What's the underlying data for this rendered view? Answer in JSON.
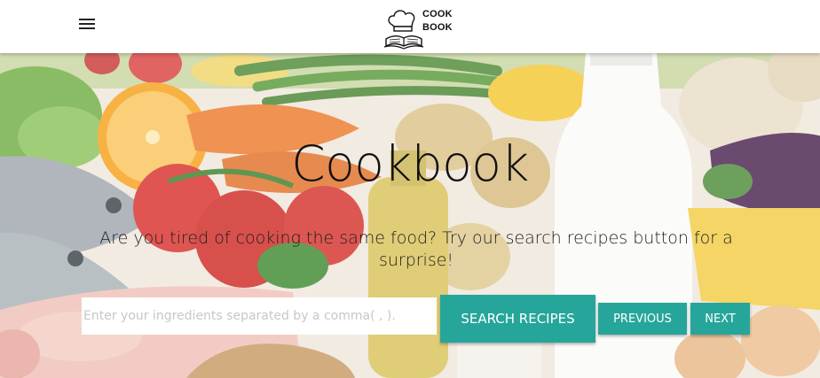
{
  "navbar": {
    "menu_icon": "hamburger-menu-icon",
    "logo_icon": "chef-hat-book-icon",
    "logo_line1": "COOK",
    "logo_line2": "BOOK"
  },
  "hero": {
    "background": "vegetables-fish-milk-photo",
    "title": "Cookbook",
    "subtitle": "Are you tired of cooking the same food? Try our search recipes button for a surprise!"
  },
  "search": {
    "placeholder": "Enter your ingredients separated by a comma( , ).",
    "value": "",
    "search_label": "SEARCH RECIPES",
    "previous_label": "PREVIOUS",
    "next_label": "NEXT"
  },
  "colors": {
    "accent": "#26a69a",
    "navbar_bg": "#ffffff",
    "text": "#111111"
  }
}
